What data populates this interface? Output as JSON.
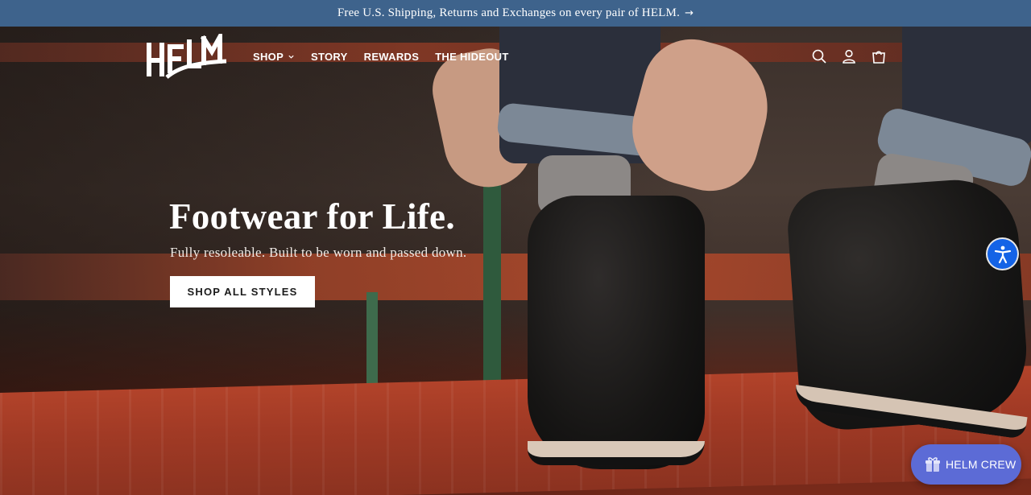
{
  "announcement": {
    "text": "Free U.S. Shipping, Returns and Exchanges on every pair of HELM.",
    "arrow": "→"
  },
  "header": {
    "logo_text": "HELM",
    "nav": [
      {
        "label": "SHOP",
        "has_dropdown": true
      },
      {
        "label": "STORY",
        "has_dropdown": false
      },
      {
        "label": "REWARDS",
        "has_dropdown": false
      },
      {
        "label": "THE HIDEOUT",
        "has_dropdown": false
      }
    ],
    "icons": [
      "search-icon",
      "account-icon",
      "cart-icon"
    ]
  },
  "hero": {
    "title": "Footwear for Life.",
    "subtitle": "Fully resoleable. Built to be worn and passed down.",
    "cta_label": "SHOP ALL STYLES"
  },
  "widgets": {
    "accessibility_icon": "accessibility-icon",
    "rewards_label": "HELM CREW",
    "rewards_icon": "gift-icon"
  },
  "colors": {
    "announcement_bg": "#3e638c",
    "accessibility_bg": "#1463e6",
    "rewards_bg": "#5c6bd6"
  }
}
